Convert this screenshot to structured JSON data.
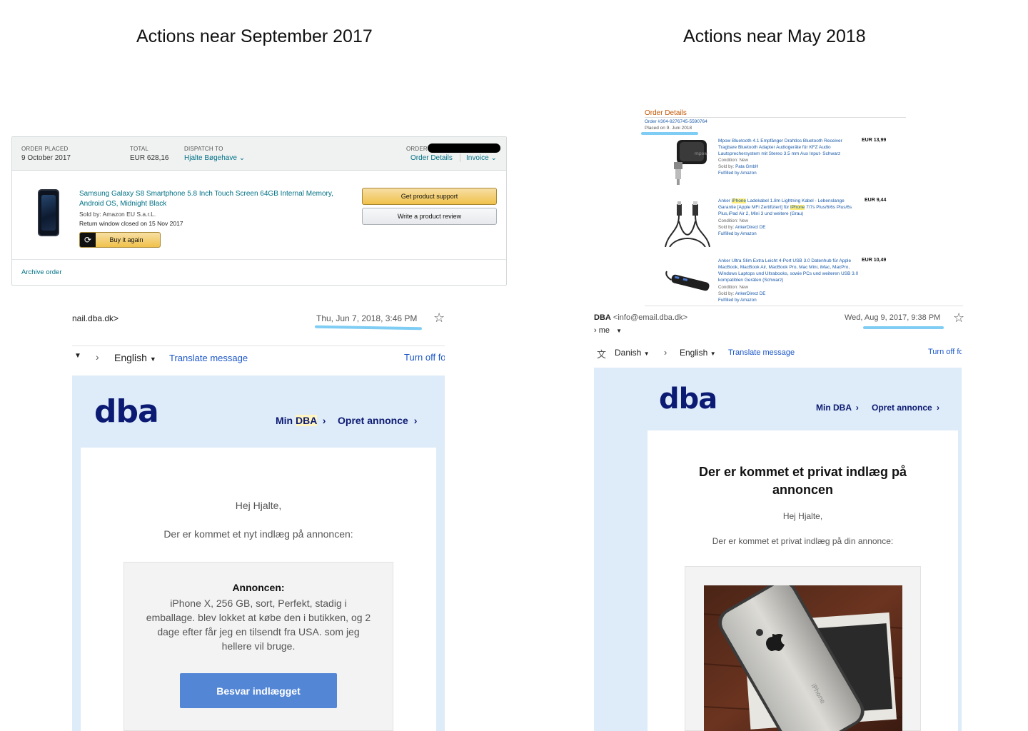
{
  "titles": {
    "left": "Actions near September 2017",
    "right": "Actions near May 2018"
  },
  "amazon_order": {
    "order_placed_label": "ORDER PLACED",
    "order_placed_value": "9 October 2017",
    "total_label": "TOTAL",
    "total_value": "EUR 628,16",
    "dispatch_label": "DISPATCH TO",
    "dispatch_value": "Hjalte Bøgehave ⌄",
    "order_label": "ORDER",
    "order_details_link": "Order Details",
    "invoice_link": "Invoice ⌄",
    "product_title": "Samsung Galaxy S8 Smartphone 5.8 Inch Touch Screen 64GB Internal Memory, Android OS, Midnight Black",
    "sold_by": "Sold by: Amazon EU S.a.r.L.",
    "return_window": "Return window closed on 15 Nov 2017",
    "buy_again": "Buy it again",
    "get_support": "Get product support",
    "write_review": "Write a product review",
    "archive_order": "Archive order"
  },
  "order_details": {
    "title": "Order Details",
    "order_number": "Order #304-9276745-5590764",
    "placed_on": "Placed on 9. Juni 2018",
    "items": [
      {
        "title": "Mpow Bluetooth 4.1 Empfänger Drahtlos Bluetooth Receiver Tragbare Bluetooth Adapter Audiogeräte für KFZ Audio Lautsprechersystem mit Stereo 3.5 mm Aux Input- Schwarz",
        "condition": "Condition: New",
        "sold_by_label": "Sold by:",
        "seller": "Pata GmbH",
        "fulfilled": "Fulfilled by Amazon",
        "price": "EUR 13,99"
      },
      {
        "title_a": "Anker ",
        "title_hl1": "iPhone",
        "title_b": " Ladekabel 1.8m Lightning Kabel - Lebenslange Garantie [Apple MFi Zertifiziert] für ",
        "title_hl2": "iPhone",
        "title_c": " 7/7s Plus/6/6s Plus/6s Plus,iPad Air 2, Mini 3 und weitere (Grau)",
        "condition": "Condition: New",
        "sold_by_label": "Sold by:",
        "seller": "AnkerDirect DE",
        "fulfilled": "Fulfilled by Amazon",
        "price": "EUR 9,44"
      },
      {
        "title": "Anker Ultra Slim Extra Leicht 4-Port USB 3.0 Datenhub für Apple MacBook, MacBook Air, MacBook Pro, Mac Mini, iMac, MacPro, Windows Laptops und Ultrabooks, sowie PCs und weiteren USB 3.0 kompatiblen Geräten (Schwarz)",
        "condition": "Condition: New",
        "sold_by_label": "Sold by:",
        "seller": "AnkerDirect DE",
        "fulfilled": "Fulfilled by Amazon",
        "price": "EUR 10,49"
      }
    ]
  },
  "left_email": {
    "from": "nail.dba.dk>",
    "date": "Thu, Jun 7, 2018, 3:46 PM",
    "language": "English",
    "translate": "Translate message",
    "turn_off": "Turn off fo",
    "logo": "dba",
    "nav_min": "Min ",
    "nav_dba": "DBA",
    "nav_opret": "Opret annonce",
    "greeting": "Hej Hjalte,",
    "intro": "Der er kommet et nyt indlæg på annoncen:",
    "box_title": "Annoncen:",
    "box_text": "iPhone X, 256 GB, sort, Perfekt, stadig i emballage. blev lokket at købe den i butikken, og 2 dage efter får jeg en tilsendt fra USA. som jeg hellere vil bruge.",
    "reply_button": "Besvar indlægget"
  },
  "right_email": {
    "from_name": "DBA",
    "from_addr": "<info@email.dba.dk>",
    "to": "me",
    "date": "Wed, Aug 9, 2017, 9:38 PM",
    "source_lang": "Danish",
    "target_lang": "English",
    "translate": "Translate message",
    "turn_off": "Turn off fo",
    "logo": "dba",
    "nav_min": "Min DBA",
    "nav_opret": "Opret annonce",
    "heading": "Der er kommet et privat indlæg på annoncen",
    "greeting": "Hej Hjalte,",
    "intro": "Der er kommet et privat indlæg på din annonce:"
  },
  "colors": {
    "dba_navy": "#0b1a73",
    "dba_bg": "#deebf8",
    "amazon_link": "#007185",
    "gmail_link": "#1a56c8",
    "scribble": "#7fcdf4",
    "button_blue": "#5486d6"
  }
}
